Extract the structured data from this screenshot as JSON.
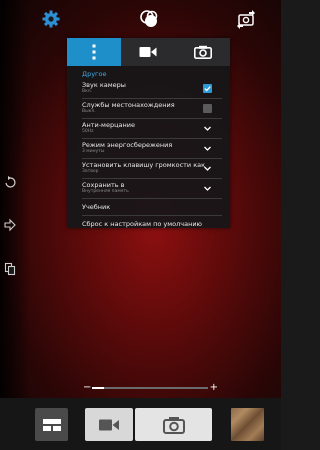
{
  "topbar": {
    "settings_icon": "gear-icon",
    "effects_icon": "effects-icon",
    "switch_camera_icon": "switch-camera-icon"
  },
  "sidebar": {
    "icons": [
      "rotate-icon",
      "arrow-right-icon",
      "copy-icon"
    ]
  },
  "settings_panel": {
    "tabs": [
      {
        "icon": "more-vertical-icon",
        "active": true
      },
      {
        "icon": "video-camera-icon",
        "active": false
      },
      {
        "icon": "camera-icon",
        "active": false
      }
    ],
    "section_title": "Другое",
    "rows": [
      {
        "label": "Звук камеры",
        "sub": "Вкл.",
        "control": "checkbox",
        "checked": true
      },
      {
        "label": "Службы местонахождения",
        "sub": "Выкл.",
        "control": "checkbox",
        "checked": false
      },
      {
        "label": "Анти-мерцание",
        "sub": "50Hz",
        "control": "dropdown"
      },
      {
        "label": "Режим энергосбережения",
        "sub": "3 минуты",
        "control": "dropdown"
      },
      {
        "label": "Установить клавишу громкости как",
        "sub": "Затвор",
        "control": "dropdown"
      },
      {
        "label": "Сохранить в",
        "sub": "Внутренняя память",
        "control": "dropdown"
      }
    ],
    "tutorial_label": "Учебник",
    "reset_label": "Сброс к настройкам по умолчанию"
  },
  "zoom": {
    "minus_label": "−",
    "plus_label": "+",
    "level": 0.1
  },
  "bottombar": {
    "mode_icon": "mode-grid-icon",
    "video_icon": "video-camera-icon",
    "shutter_icon": "camera-icon",
    "gallery": "gallery-thumbnail"
  },
  "colors": {
    "accent": "#1f8fc9",
    "section_title": "#3fa9e3",
    "checkbox_on": "#2d9ad6"
  }
}
